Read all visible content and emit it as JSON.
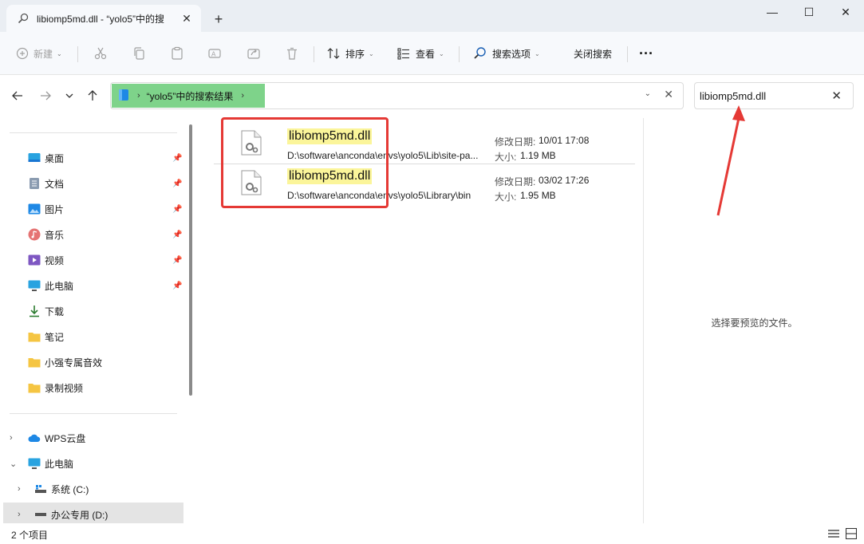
{
  "tab": {
    "title": "libiomp5md.dll - “yolo5”中的搜"
  },
  "window": {
    "minimize": "—",
    "maximize": "☐",
    "close": "✕"
  },
  "toolbar": {
    "new_label": "新建",
    "sort_label": "排序",
    "view_label": "查看",
    "search_options_label": "搜索选项",
    "close_search_label": "关闭搜索",
    "more_label": "···"
  },
  "address": {
    "crumb": "“yolo5”中的搜索结果"
  },
  "search": {
    "value": "libiomp5md.dll"
  },
  "sidebar": {
    "quick_access": [
      {
        "label": "桌面",
        "icon": "desktop-icon"
      },
      {
        "label": "文档",
        "icon": "documents-icon"
      },
      {
        "label": "图片",
        "icon": "pictures-icon"
      },
      {
        "label": "音乐",
        "icon": "music-icon"
      },
      {
        "label": "视频",
        "icon": "videos-icon"
      },
      {
        "label": "此电脑",
        "icon": "this-pc-icon"
      },
      {
        "label": "下载",
        "icon": "downloads-icon"
      },
      {
        "label": "笔记",
        "icon": "folder-icon"
      },
      {
        "label": "小强专属音效",
        "icon": "folder-icon"
      },
      {
        "label": "录制视频",
        "icon": "folder-icon"
      }
    ],
    "tree": [
      {
        "label": "WPS云盘",
        "icon": "cloud-icon"
      },
      {
        "label": "此电脑",
        "icon": "this-pc-icon"
      },
      {
        "label": "系统 (C:)",
        "icon": "drive-c-icon"
      },
      {
        "label": "办公专用 (D:)",
        "icon": "drive-d-icon"
      }
    ]
  },
  "results": [
    {
      "name": "libiomp5md.dll",
      "path": "D:\\software\\anconda\\envs\\yolo5\\Lib\\site-pa...",
      "date_label": "修改日期:",
      "date": "10/01 17:08",
      "size_label": "大小:",
      "size": "1.19 MB"
    },
    {
      "name": "libiomp5md.dll",
      "path": "D:\\software\\anconda\\envs\\yolo5\\Library\\bin",
      "date_label": "修改日期:",
      "date": "03/02 17:26",
      "size_label": "大小:",
      "size": "1.95 MB"
    }
  ],
  "preview": {
    "message": "选择要预览的文件。"
  },
  "status": {
    "count": "2 个项目"
  },
  "colors": {
    "address_highlight": "#7ed38a",
    "name_highlight": "#fbf59a",
    "annotation_red": "#e53935"
  }
}
